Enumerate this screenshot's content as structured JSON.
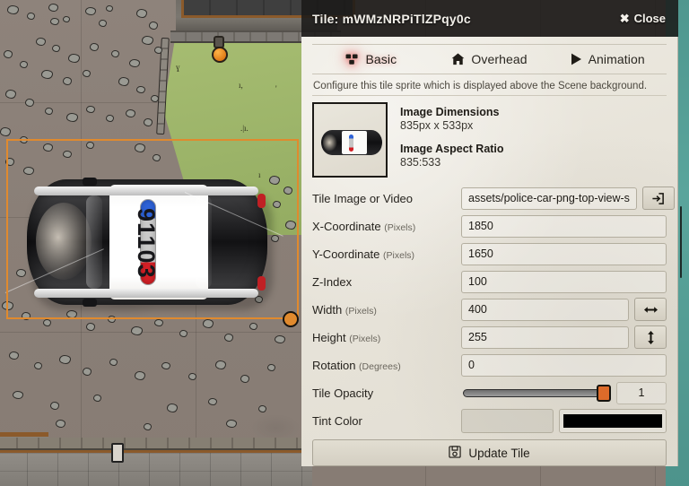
{
  "dialog": {
    "title": "Tile: mWMzNRPiTlZPqy0c",
    "close_label": "Close",
    "close_icon": "close-icon",
    "hint": "Configure this tile sprite which is displayed above the Scene background.",
    "tabs": [
      {
        "label": "Basic",
        "icon": "cubes-icon",
        "active": true
      },
      {
        "label": "Overhead",
        "icon": "home-icon",
        "active": false
      },
      {
        "label": "Animation",
        "icon": "play-icon",
        "active": false
      }
    ],
    "preview": {
      "dimensions_title": "Image Dimensions",
      "dimensions_value": "835px x 533px",
      "aspect_title": "Image Aspect Ratio",
      "aspect_value": "835:533",
      "thumbnail_alt": "police-car-top-view-thumbnail"
    },
    "fields": [
      {
        "label": "Tile Image or Video",
        "unit": "",
        "value": "assets/police-car-png-top-view-s",
        "button_icon": "file-import-icon"
      },
      {
        "label": "X-Coordinate",
        "unit": "(Pixels)",
        "value": "1850",
        "button_icon": ""
      },
      {
        "label": "Y-Coordinate",
        "unit": "(Pixels)",
        "value": "1650",
        "button_icon": ""
      },
      {
        "label": "Z-Index",
        "unit": "",
        "value": "100",
        "button_icon": ""
      },
      {
        "label": "Width",
        "unit": "(Pixels)",
        "value": "400",
        "button_icon": "arrows-h-icon"
      },
      {
        "label": "Height",
        "unit": "(Pixels)",
        "value": "255",
        "button_icon": "arrows-v-icon"
      },
      {
        "label": "Rotation",
        "unit": "(Degrees)",
        "value": "0",
        "button_icon": ""
      }
    ],
    "opacity": {
      "label": "Tile Opacity",
      "value": "1",
      "fill_percent": 100
    },
    "tint": {
      "label": "Tint Color",
      "value": "",
      "swatch_color": "#000000"
    },
    "update_button": {
      "label": "Update Tile",
      "icon": "save-icon"
    }
  },
  "scene": {
    "car_number": "91103",
    "selection": {
      "accent_color": "#e08a2e",
      "handle_color": "#e08a2e"
    },
    "palette": {
      "ground": "#8a7f77",
      "grass": "#9cb469",
      "stone": "#7b7770",
      "teal": "#5aa59c",
      "wood_trim": "#8b5a2b",
      "lamp": "#e07b18"
    }
  }
}
